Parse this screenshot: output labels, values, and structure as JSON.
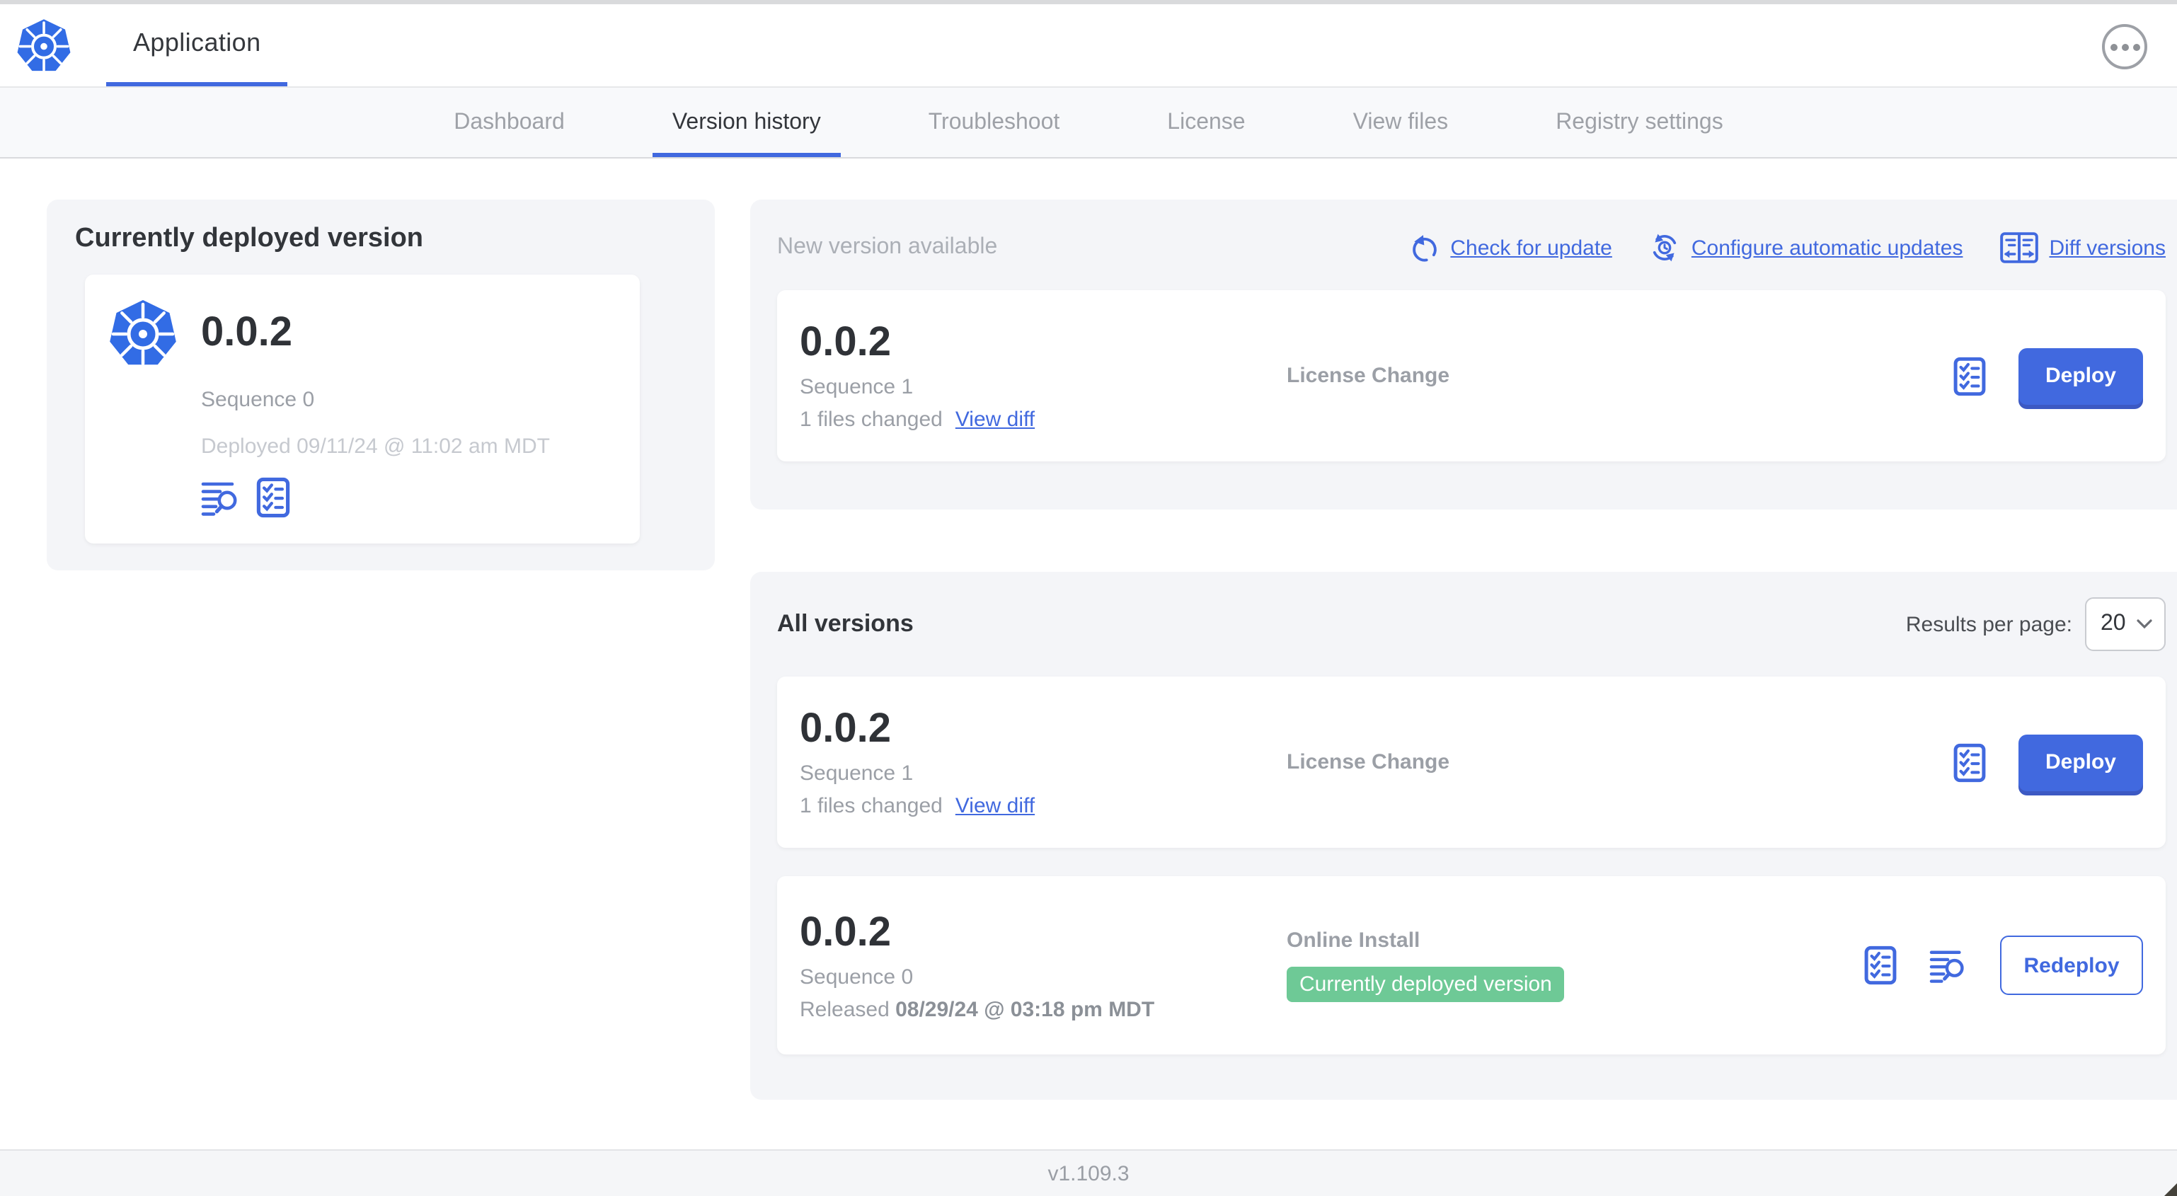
{
  "colors": {
    "accent_blue": "#4169df",
    "kubernetes_blue": "#326ce5",
    "badge_green": "#6ec996",
    "panel_gray": "#f4f5f8",
    "text_dark": "#32353a",
    "text_muted": "#9b9fa6"
  },
  "icons": {
    "brand": "kubernetes-logo",
    "menu": "ellipsis-icon",
    "check_update": "refresh-icon",
    "auto_update": "scheduled-update-icon",
    "diff": "diff-columns-icon",
    "preflight": "checklist-icon",
    "logs": "logs-search-icon",
    "select": "chevron-down-icon"
  },
  "header": {
    "app_title": "Application"
  },
  "nav": {
    "active_tab": "Version history",
    "tabs": [
      {
        "label": "Dashboard"
      },
      {
        "label": "Version history"
      },
      {
        "label": "Troubleshoot"
      },
      {
        "label": "License"
      },
      {
        "label": "View files"
      },
      {
        "label": "Registry settings"
      }
    ]
  },
  "current_card": {
    "title": "Currently deployed version",
    "version": "0.0.2",
    "sequence": "Sequence 0",
    "deployed": "Deployed 09/11/24 @ 11:02 am MDT"
  },
  "new_version": {
    "title": "New version available",
    "actions": {
      "check": "Check for update",
      "auto": "Configure automatic updates",
      "diff": "Diff versions"
    },
    "row": {
      "version": "0.0.2",
      "sequence": "Sequence 1",
      "files_changed": "1 files changed",
      "view_diff": "View diff",
      "source": "License Change",
      "deploy": "Deploy"
    }
  },
  "all_versions": {
    "title": "All versions",
    "results_label": "Results per page:",
    "results_value": "20",
    "row1": {
      "version": "0.0.2",
      "sequence": "Sequence 1",
      "files_changed": "1 files changed",
      "view_diff": "View diff",
      "source": "License Change",
      "deploy": "Deploy"
    },
    "row2": {
      "version": "0.0.2",
      "sequence": "Sequence 0",
      "released_prefix": "Released ",
      "released_date": "08/29/24 @ 03:18 pm MDT",
      "source": "Online Install",
      "badge": "Currently deployed version",
      "redeploy": "Redeploy"
    }
  },
  "footer": {
    "app_version": "v1.109.3"
  }
}
